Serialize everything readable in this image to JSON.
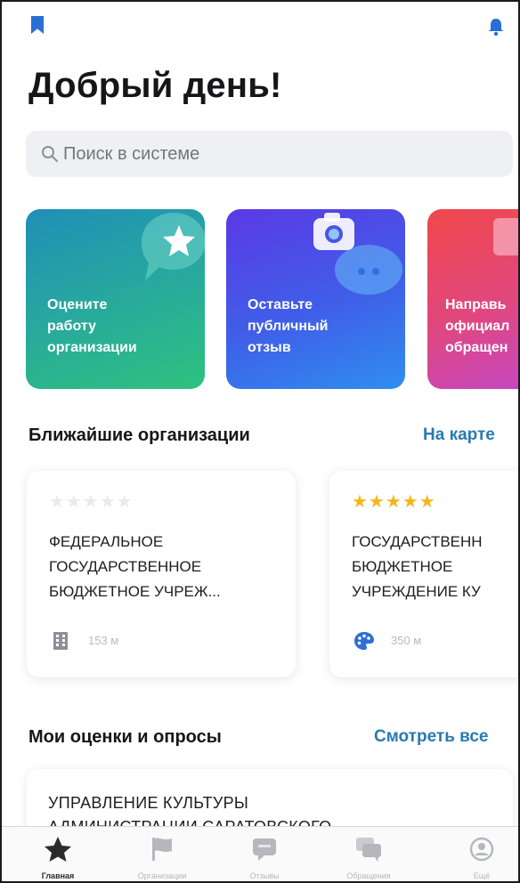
{
  "header": {
    "greeting": "Добрый день!"
  },
  "search": {
    "placeholder": "Поиск в системе"
  },
  "actions": [
    {
      "label": "Оцените\nработу\nорганизации",
      "icon": "star-bubble-icon"
    },
    {
      "label": "Оставьте\nпубличный\nотзыв",
      "icon": "camera-bubble-icon"
    },
    {
      "label": "Направь\nофициал\nобращен",
      "icon": "document-icon"
    }
  ],
  "nearby": {
    "title": "Ближайшие организации",
    "link": "На карте",
    "items": [
      {
        "name": "ФЕДЕРАЛЬНОЕ\nГОСУДАРСТВЕННОЕ\nБЮДЖЕТНОЕ УЧРЕЖ...",
        "rating": 0,
        "distance": "153 м",
        "icon": "building-icon"
      },
      {
        "name": "ГОСУДАРСТВЕНН\nБЮДЖЕТНОЕ\nУЧРЕЖДЕНИЕ КУ",
        "rating": 5,
        "distance": "350 м",
        "icon": "palette-icon"
      }
    ]
  },
  "surveys": {
    "title": "Мои оценки и опросы",
    "link": "Смотреть все",
    "item_title": "УПРАВЛЕНИЕ КУЛЬТУРЫ",
    "item_subtitle": "АДМИНИСТРАЦИИ САРАТОВСКОГО"
  },
  "tabbar": {
    "items": [
      {
        "label": "Главная",
        "icon": "star-icon",
        "active": true
      },
      {
        "label": "Организации",
        "icon": "flag-icon",
        "active": false
      },
      {
        "label": "Отзывы",
        "icon": "chat-bubble-icon",
        "active": false
      },
      {
        "label": "Обращения",
        "icon": "messages-icon",
        "active": false
      },
      {
        "label": "Ещё",
        "icon": "profile-icon",
        "active": false
      }
    ]
  },
  "colors": {
    "accent": "#2a7ab0",
    "star": "#f4b71b",
    "bookmark": "#2a6fd3"
  }
}
